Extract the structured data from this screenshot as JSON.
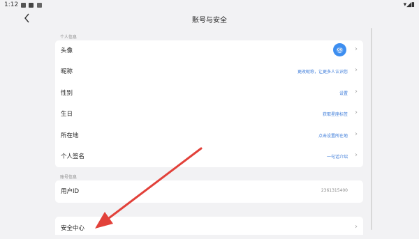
{
  "status_bar": {
    "time": "1:12",
    "right_icons": "▾◢▮"
  },
  "header": {
    "title": "账号与安全"
  },
  "personal_info": {
    "section_label": "个人信息",
    "rows": [
      {
        "label": "头像",
        "value": ""
      },
      {
        "label": "昵称",
        "value": "更改昵称，让更多人认识您"
      },
      {
        "label": "性别",
        "value": "设置"
      },
      {
        "label": "生日",
        "value": "获取星座标签"
      },
      {
        "label": "所在地",
        "value": "点击设置所在地"
      },
      {
        "label": "个人签名",
        "value": "一句话介绍"
      }
    ]
  },
  "account_info": {
    "section_label": "账号信息",
    "user_id_label": "用户ID",
    "user_id_value": "2361315400"
  },
  "security": {
    "label": "安全中心"
  },
  "icons": {
    "back": "chevron-left-icon",
    "chevron": "chevron-right-icon",
    "avatar": "avatar-icon",
    "annotation": "red-arrow"
  },
  "colors": {
    "accent": "#3a7ad9",
    "annotation_arrow": "#e2413a",
    "avatar": "#3d8ef0"
  }
}
